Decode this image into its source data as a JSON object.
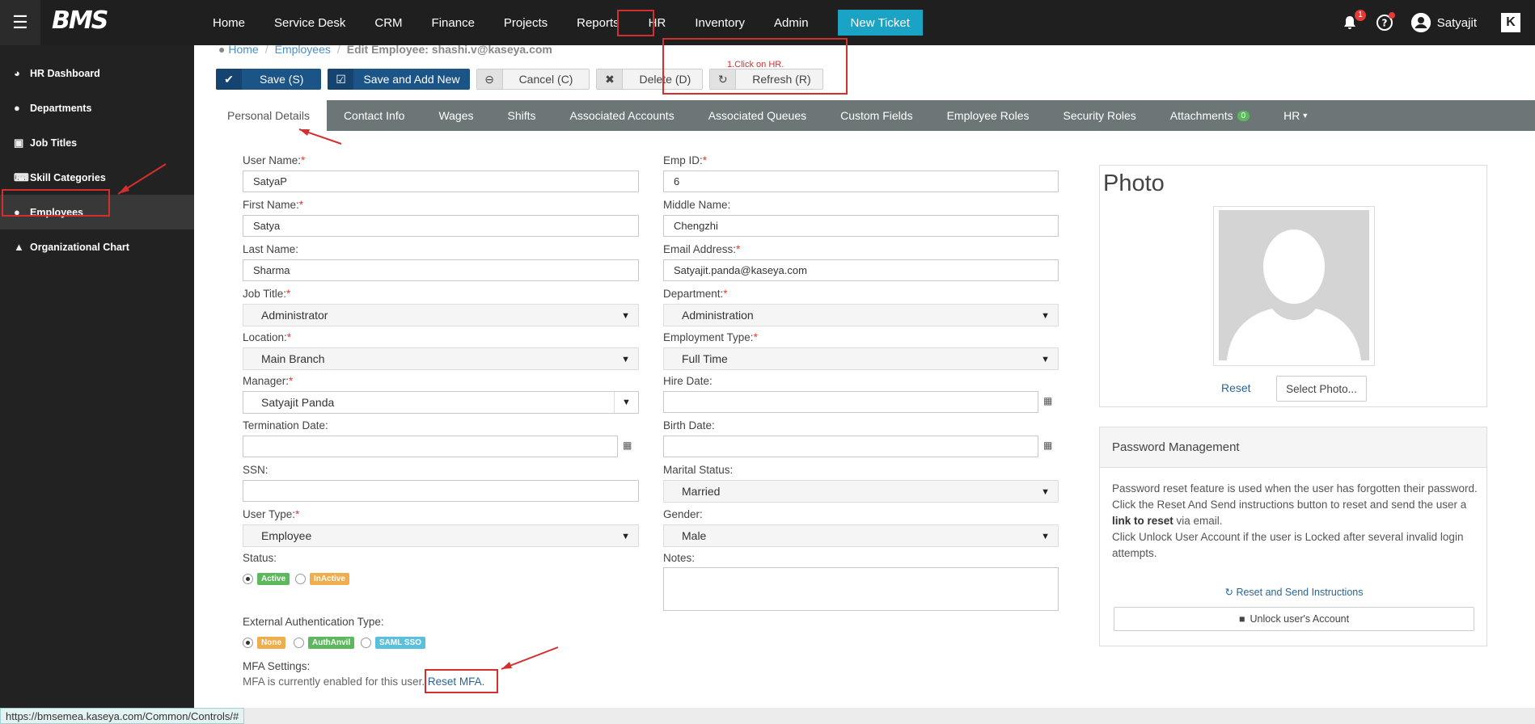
{
  "topbar": {
    "menu_icon": "hamburger-icon",
    "logo": "BMS",
    "nav": [
      "Home",
      "Service Desk",
      "CRM",
      "Finance",
      "Projects",
      "Reports",
      "HR",
      "Inventory",
      "Admin"
    ],
    "new_ticket": "New Ticket",
    "notification_count": "1",
    "username": "Satyajit",
    "brand_mark": "K"
  },
  "sidebar": {
    "items": [
      {
        "icon": "dashboard-icon",
        "label": "HR Dashboard"
      },
      {
        "icon": "users-icon",
        "label": "Departments"
      },
      {
        "icon": "briefcase-icon",
        "label": "Job Titles"
      },
      {
        "icon": "keyboard-icon",
        "label": "Skill Categories"
      },
      {
        "icon": "users-icon",
        "label": "Employees"
      },
      {
        "icon": "org-chart-icon",
        "label": "Organizational Chart"
      }
    ],
    "active": "Employees"
  },
  "breadcrumb": {
    "home": "Home",
    "employees": "Employees",
    "current": "Edit Employee: shashi.v@kaseya.com"
  },
  "toolbar": {
    "save": "Save (S)",
    "save_add": "Save and Add New",
    "cancel": "Cancel (C)",
    "delete": "Delete (D)",
    "refresh": "Refresh (R)"
  },
  "tabs": [
    "Personal Details",
    "Contact Info",
    "Wages",
    "Shifts",
    "Associated Accounts",
    "Associated Queues",
    "Custom Fields",
    "Employee Roles",
    "Security Roles",
    "Attachments",
    "HR"
  ],
  "attachments_count": "0",
  "form": {
    "user_name": {
      "label": "User Name:",
      "value": "SatyaP"
    },
    "emp_id": {
      "label": "Emp ID:",
      "value": "6"
    },
    "first_name": {
      "label": "First Name:",
      "value": "Satya"
    },
    "middle_name": {
      "label": "Middle Name:",
      "value": "Chengzhi"
    },
    "last_name": {
      "label": "Last Name:",
      "value": "Sharma"
    },
    "email": {
      "label": "Email Address:",
      "value": "Satyajit.panda@kaseya.com"
    },
    "job_title": {
      "label": "Job Title:",
      "value": "Administrator"
    },
    "department": {
      "label": "Department:",
      "value": "Administration"
    },
    "location": {
      "label": "Location:",
      "value": "Main Branch"
    },
    "employment_type": {
      "label": "Employment Type:",
      "value": "Full Time"
    },
    "manager": {
      "label": "Manager:",
      "value": "Satyajit Panda"
    },
    "hire_date": {
      "label": "Hire Date:",
      "value": ""
    },
    "termination_date": {
      "label": "Termination Date:",
      "value": ""
    },
    "birth_date": {
      "label": "Birth Date:",
      "value": ""
    },
    "ssn": {
      "label": "SSN:",
      "value": ""
    },
    "marital_status": {
      "label": "Marital Status:",
      "value": "Married"
    },
    "user_type": {
      "label": "User Type:",
      "value": "Employee"
    },
    "gender": {
      "label": "Gender:",
      "value": "Male"
    },
    "status": {
      "label": "Status:",
      "options": [
        "Active",
        "InActive"
      ],
      "selected": "Active"
    },
    "notes": {
      "label": "Notes:",
      "value": ""
    },
    "ext_auth": {
      "label": "External Authentication Type:",
      "options": [
        "None",
        "AuthAnvil",
        "SAML SSO"
      ],
      "selected": "None"
    },
    "mfa": {
      "label": "MFA Settings:",
      "text": "MFA is currently enabled for this user.",
      "link": "Reset MFA."
    }
  },
  "photo": {
    "title": "Photo",
    "reset": "Reset",
    "select": "Select Photo..."
  },
  "password": {
    "title": "Password Management",
    "line1": "Password reset feature is used when the user has forgotten their password.",
    "line2a": "Click the Reset And Send instructions button to reset and send the user a ",
    "line2b": "link to reset",
    "line2c": " via email.",
    "line3": "Click Unlock User Account if the user is Locked after several invalid login attempts.",
    "reset_send": "Reset and Send Instructions",
    "unlock": "Unlock user's Account"
  },
  "annotation": {
    "text": "1.Click on HR.",
    "color": "#d32f2f"
  },
  "status_url": "https://bmsemea.kaseya.com/Common/Controls/#",
  "colors": {
    "topbar": "#1f1f1f",
    "sidebar": "#222222",
    "primary": "#1b5486",
    "new_ticket": "#1aa3c5",
    "tabs": "#6d7676"
  }
}
